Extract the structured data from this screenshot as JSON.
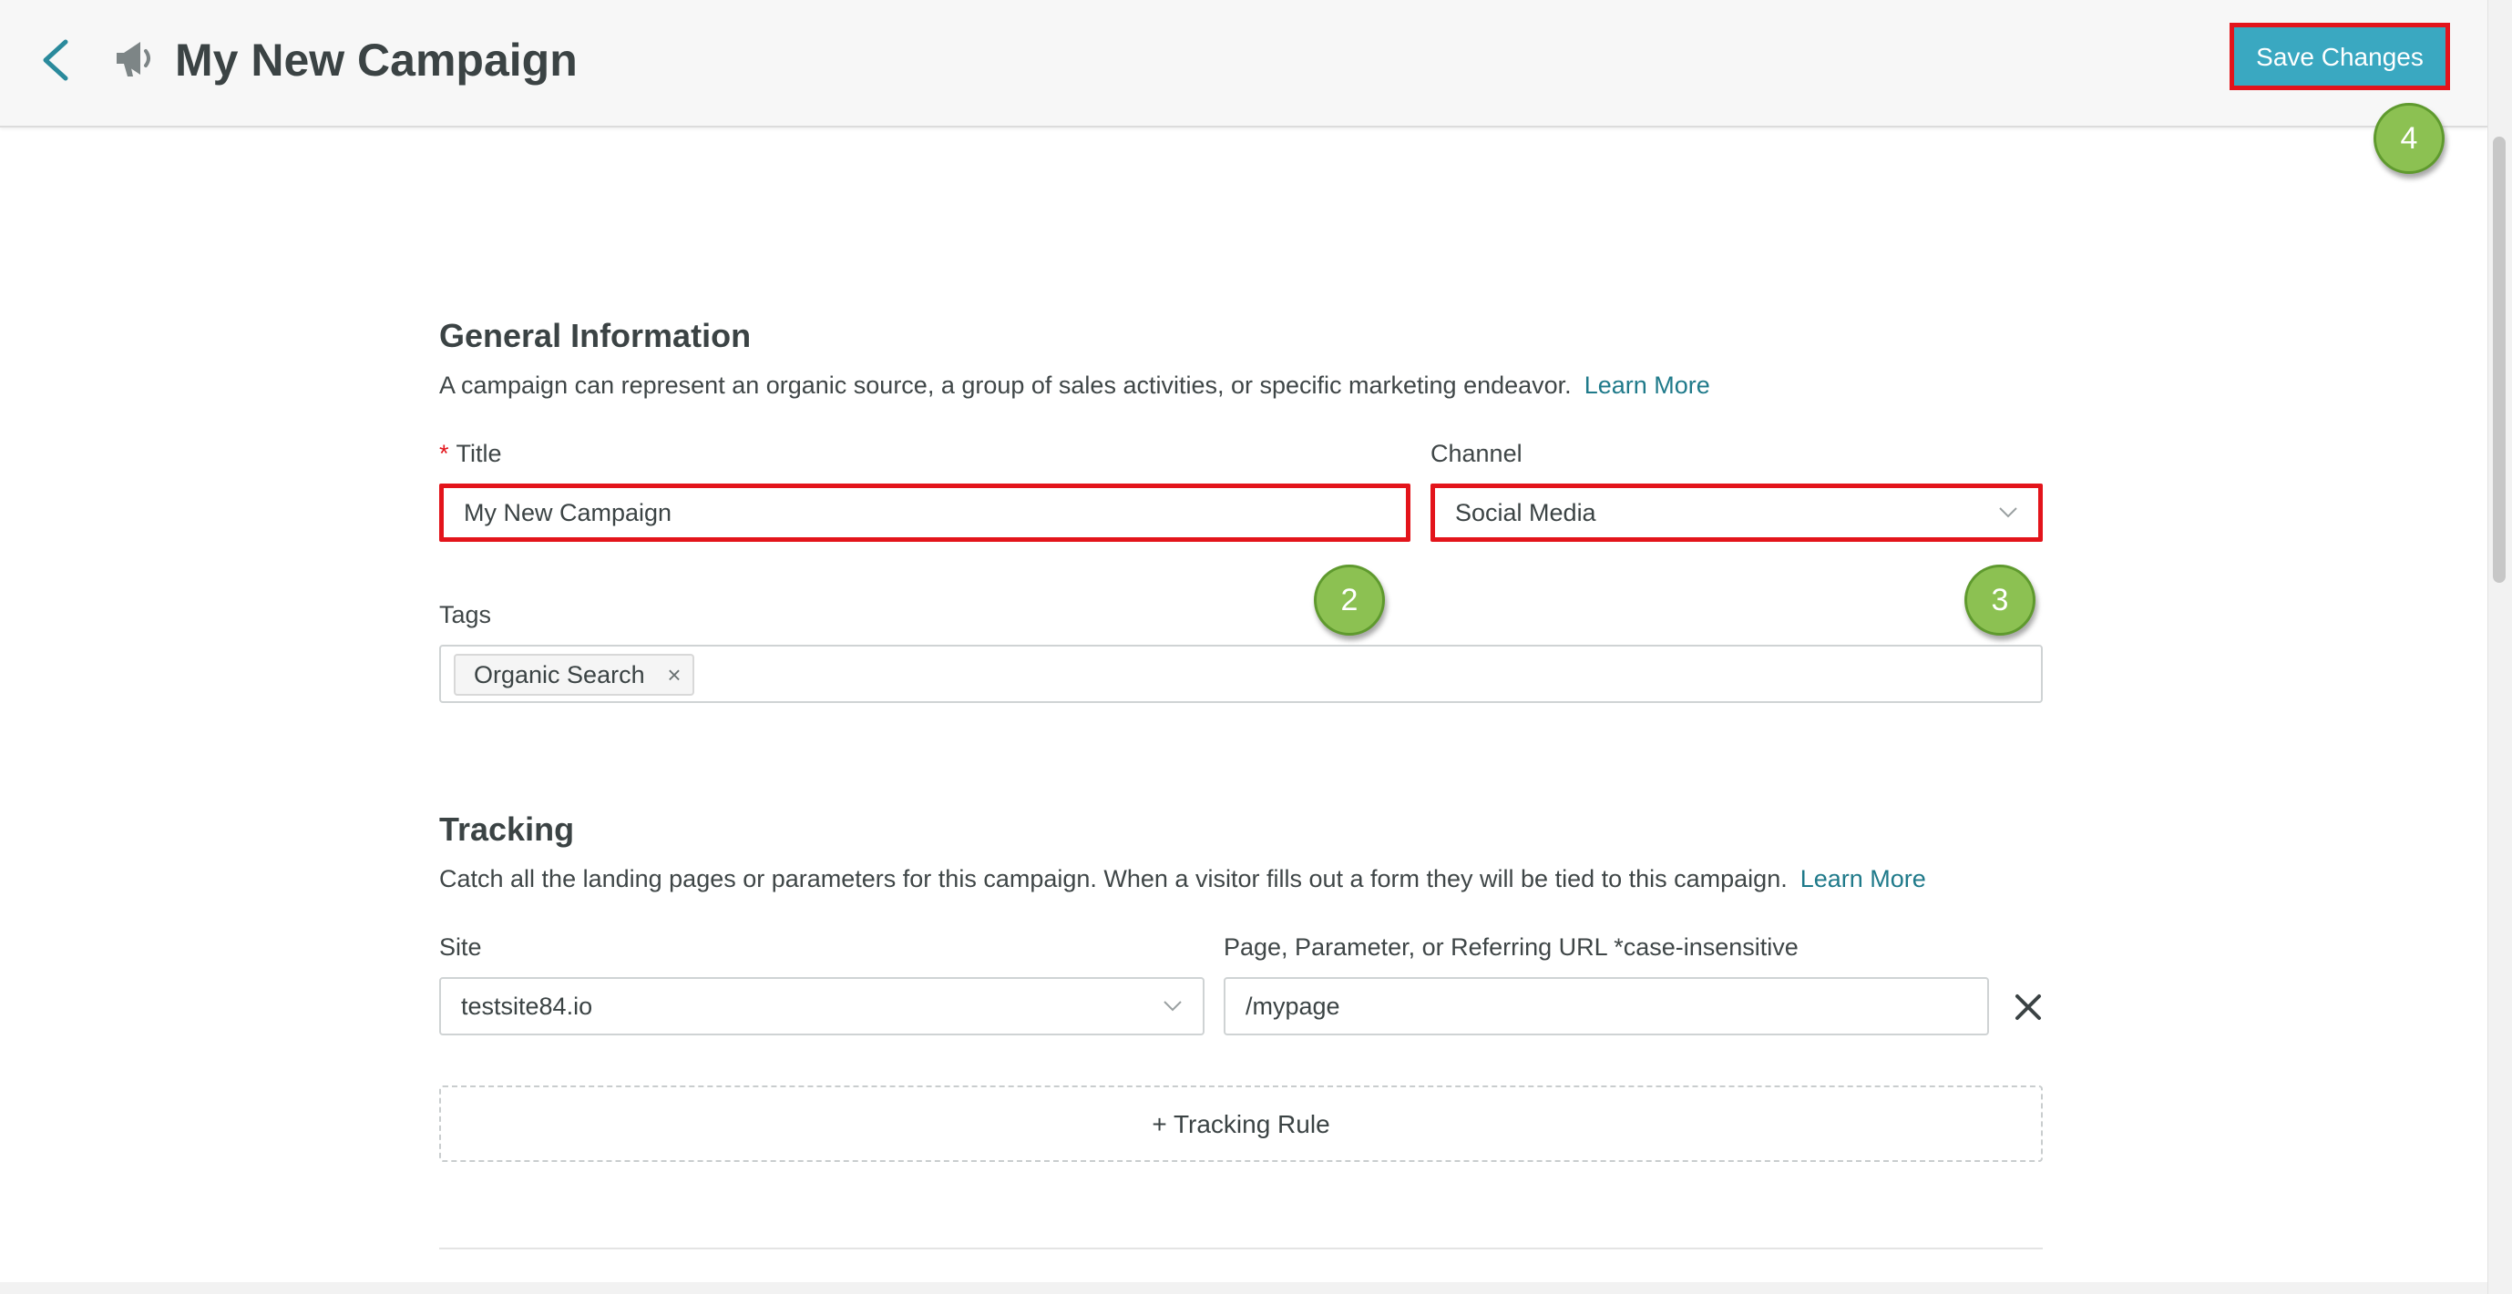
{
  "header": {
    "title": "My New Campaign",
    "save_label": "Save Changes",
    "back_icon": "chevron-left-icon",
    "page_icon": "megaphone-icon"
  },
  "general": {
    "heading": "General Information",
    "description": "A campaign can represent an organic source, a group of sales activities, or specific marketing endeavor.",
    "learn_more": "Learn More",
    "title_required_mark": "*",
    "title_label": "Title",
    "title_value": "My New Campaign",
    "channel_label": "Channel",
    "channel_value": "Social Media",
    "tags_label": "Tags",
    "tags": [
      "Organic Search"
    ],
    "tag_remove_glyph": "×"
  },
  "tracking": {
    "heading": "Tracking",
    "description": "Catch all the landing pages or parameters for this campaign. When a visitor fills out a form they will be tied to this campaign.",
    "learn_more": "Learn More",
    "site_label": "Site",
    "site_value": "testsite84.io",
    "url_label": "Page, Parameter, or Referring URL *case-insensitive",
    "url_value": "/mypage",
    "add_rule_label": "+ Tracking Rule"
  },
  "callouts": {
    "title_step": "2",
    "channel_step": "3",
    "save_step": "4"
  },
  "colors": {
    "accent": "#3aa8c1",
    "link": "#1f7a8a",
    "highlight": "#e3141b",
    "callout": "#8cc152"
  }
}
